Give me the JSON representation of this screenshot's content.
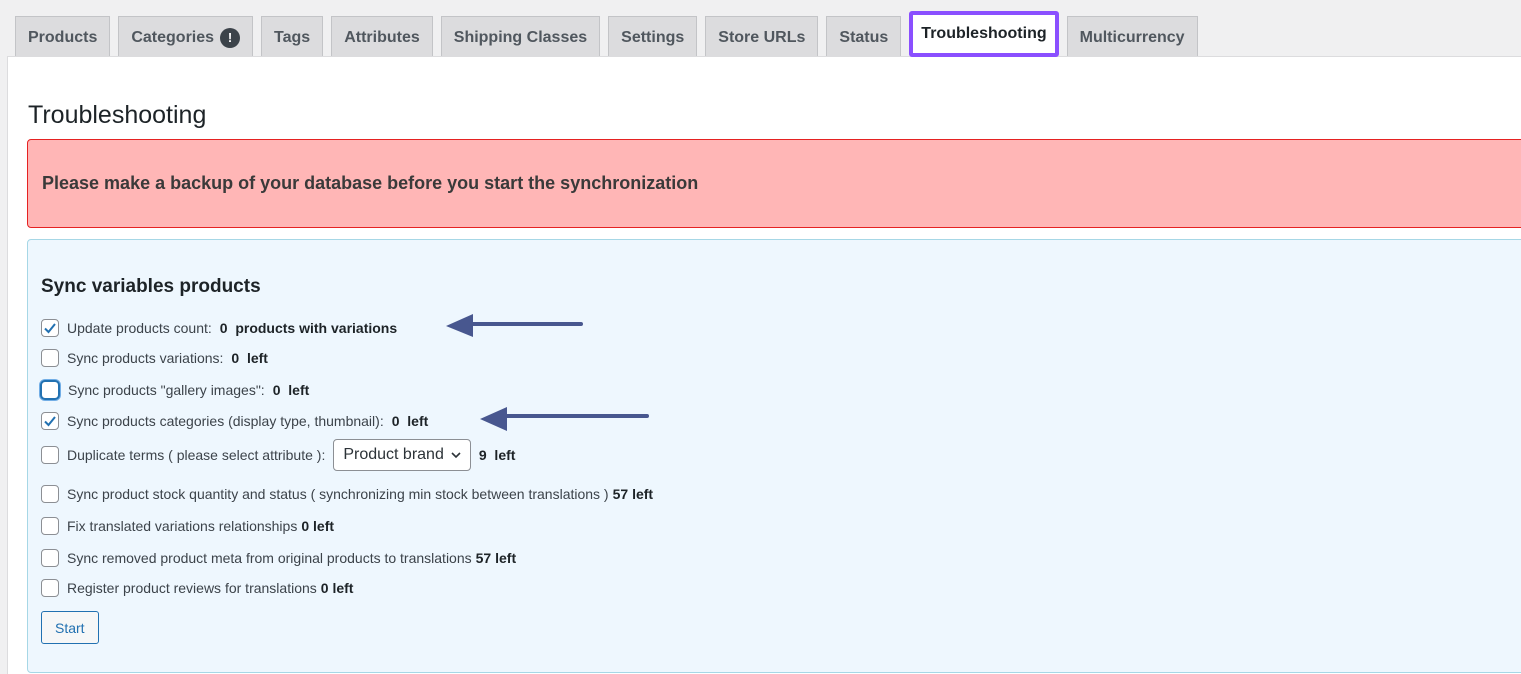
{
  "tabs": [
    {
      "label": "Products",
      "active": false
    },
    {
      "label": "Categories",
      "active": false,
      "badge": "!"
    },
    {
      "label": "Tags",
      "active": false
    },
    {
      "label": "Attributes",
      "active": false
    },
    {
      "label": "Shipping Classes",
      "active": false
    },
    {
      "label": "Settings",
      "active": false
    },
    {
      "label": "Store URLs",
      "active": false
    },
    {
      "label": "Status",
      "active": false
    },
    {
      "label": "Troubleshooting",
      "active": true
    },
    {
      "label": "Multicurrency",
      "active": false
    }
  ],
  "page_title": "Troubleshooting",
  "notice": "Please make a backup of your database before you start the synchronization",
  "sync": {
    "heading": "Sync variables products",
    "options": [
      {
        "label": "Update products count:",
        "value": "0  products with variations",
        "checked": true
      },
      {
        "label": "Sync products variations:",
        "value": "0  left",
        "checked": false
      },
      {
        "label": "Sync products \"gallery images\":",
        "value": "0  left",
        "checked": false,
        "focused": true
      },
      {
        "label": "Sync products categories (display type, thumbnail):",
        "value": "0  left",
        "checked": true
      },
      {
        "label": "Duplicate terms ( please select attribute ):",
        "value": "9  left",
        "checked": false,
        "select": "Product brand"
      },
      {
        "label": "Sync product stock quantity and status ( synchronizing min stock between translations )",
        "value": "57 left",
        "checked": false
      },
      {
        "label": "Fix translated variations relationships",
        "value": "0 left",
        "checked": false
      },
      {
        "label": "Sync removed product meta from original products to translations",
        "value": "57 left",
        "checked": false
      },
      {
        "label": "Register product reviews for translations",
        "value": "0 left",
        "checked": false
      }
    ],
    "start_label": "Start"
  },
  "annotation_color": "#48578f"
}
